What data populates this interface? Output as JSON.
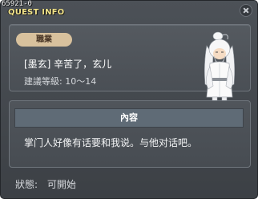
{
  "quest_id": "65921-0",
  "window": {
    "title": "QUEST INFO"
  },
  "quest": {
    "category": "職業",
    "name": "[墨玄] 辛苦了，玄儿",
    "level": "建議等級: 10～14"
  },
  "content": {
    "header": "內容",
    "text": "掌门人好像有话要和我说。与他对话吧。"
  },
  "status": {
    "label": "狀態:",
    "value": "可開始"
  },
  "icons": {
    "close": "close-icon",
    "npc": "npc-portrait-white-haired-elder"
  },
  "colors": {
    "title": "#f3e58a",
    "badge_bg": "#d8c19d",
    "header_bg": "#5f6b76",
    "window_bg": "#45494e"
  }
}
